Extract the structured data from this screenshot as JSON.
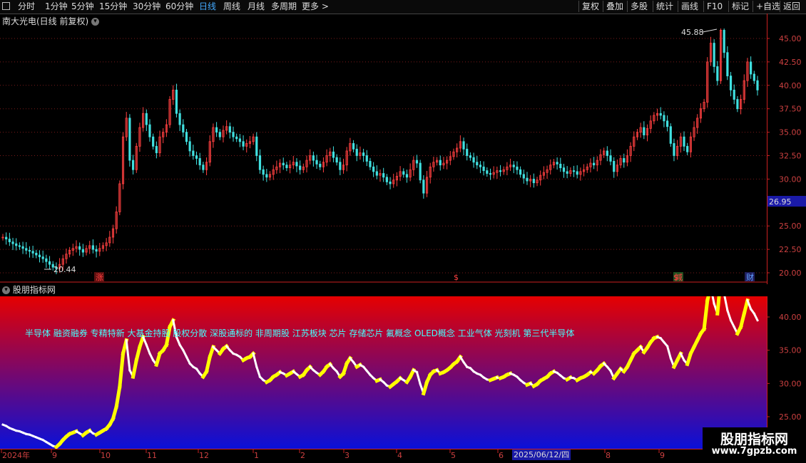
{
  "toolbar": {
    "periods": [
      "分时",
      "1分钟",
      "5分钟",
      "15分钟",
      "30分钟",
      "60分钟",
      "日线",
      "周线",
      "月线",
      "多周期",
      "更多 >"
    ],
    "active_period": "日线",
    "right_buttons": [
      "复权",
      "叠加",
      "多股",
      "统计",
      "画线",
      "F10",
      "标记",
      "+自选",
      "返回"
    ]
  },
  "stock": {
    "title": "南大光电(日线 前复权)"
  },
  "price_axis": {
    "labels": [
      "45.00",
      "42.50",
      "40.00",
      "37.50",
      "35.00",
      "32.50",
      "30.00",
      "25.00",
      "22.50",
      "20.00"
    ],
    "current_price": "26.95",
    "ylim": [
      19.5,
      46.5
    ]
  },
  "annotations": {
    "high": "45.88",
    "low": "20.44"
  },
  "markers": [
    "涨",
    "$",
    "$",
    "減",
    "财"
  ],
  "indicator": {
    "title": "股朋指标网",
    "axis_labels": [
      "40.00",
      "35.00",
      "30.00",
      "25.00"
    ],
    "concepts": "半导体 融资融券 专精特新 大基金持股 股权分散 深股通标的 非周期股 江苏板块 芯片 存储芯片 氟概念 OLED概念 工业气体 光刻机 第三代半导体"
  },
  "time_axis": {
    "labels": [
      "2024年",
      "9",
      "10",
      "11",
      "12",
      "1",
      "2",
      "3",
      "4",
      "5",
      "6",
      "8",
      "9"
    ],
    "highlight": "2025/06/12/四"
  },
  "watermark": {
    "title": "股朋指标网",
    "url": "www.7gpzb.com"
  },
  "colors": {
    "up": "#ff4040",
    "down": "#40e0e0",
    "bg": "#000000",
    "indicator_top": "#e00000",
    "indicator_bottom": "#0a10d0",
    "line_up": "#ffff00",
    "line_down": "#ffffff"
  },
  "chart_data": {
    "type": "line",
    "series": [
      {
        "values": [
          23.8,
          23.6,
          23.3,
          23.1,
          22.9,
          22.8,
          22.6,
          22.4,
          22.3,
          22.1,
          21.9,
          21.7,
          21.5,
          21.2,
          20.9,
          20.6,
          20.44,
          20.9,
          21.5,
          22.0,
          22.4,
          22.6,
          22.8,
          22.5,
          22.2,
          22.6,
          22.9,
          22.5,
          22.3,
          22.6,
          22.9,
          23.2,
          23.8,
          24.7,
          26.5,
          29.5,
          34.5,
          36.5,
          32.0,
          31.0,
          33.5,
          35.5,
          37.0,
          35.8,
          34.5,
          33.5,
          32.8,
          34.5,
          35.0,
          35.8,
          38.5,
          39.5,
          37.0,
          35.8,
          35.0,
          34.0,
          33.0,
          32.5,
          32.2,
          31.5,
          31.0,
          31.8,
          34.0,
          35.5,
          35.0,
          34.5,
          35.2,
          35.6,
          35.0,
          34.5,
          34.3,
          34.0,
          33.5,
          33.8,
          34.0,
          34.5,
          32.5,
          31.0,
          30.5,
          30.2,
          30.5,
          31.0,
          31.3,
          31.7,
          31.5,
          31.2,
          31.5,
          31.8,
          31.4,
          31.0,
          31.3,
          32.0,
          32.5,
          32.0,
          31.6,
          31.3,
          31.8,
          32.5,
          32.9,
          32.3,
          31.8,
          31.0,
          31.5,
          33.0,
          33.8,
          33.2,
          32.5,
          32.8,
          32.5,
          31.9,
          31.3,
          30.8,
          30.4,
          30.6,
          30.2,
          29.7,
          29.5,
          29.9,
          30.3,
          30.8,
          30.5,
          30.2,
          31.0,
          32.0,
          31.7,
          29.9,
          28.5,
          30.2,
          31.3,
          31.8,
          32.0,
          31.5,
          31.7,
          32.0,
          32.4,
          32.9,
          33.3,
          34.0,
          33.2,
          32.5,
          32.3,
          31.8,
          31.5,
          31.3,
          30.9,
          30.6,
          30.5,
          30.7,
          30.9,
          30.8,
          31.0,
          31.3,
          31.5,
          31.3,
          31.0,
          30.5,
          30.1,
          29.8,
          30.0,
          29.6,
          29.9,
          30.4,
          30.7,
          31.0,
          31.5,
          31.8,
          31.6,
          31.2,
          30.8,
          30.6,
          30.9,
          30.8,
          30.5,
          30.8,
          31.0,
          31.3,
          31.7,
          31.5,
          32.0,
          32.6,
          33.0,
          32.5,
          31.9,
          30.8,
          31.5,
          32.2,
          31.8,
          32.5,
          33.5,
          34.5,
          35.0,
          35.5,
          34.7,
          35.4,
          36.2,
          36.8,
          37.0,
          36.8,
          36.2,
          35.6,
          33.8,
          32.5,
          33.5,
          34.5,
          33.5,
          32.9,
          34.5,
          35.5,
          36.5,
          37.5,
          38.2,
          42.5,
          44.5,
          42.0,
          40.5,
          45.88,
          43.5,
          41.0,
          39.5,
          38.5,
          37.5,
          38.5,
          40.5,
          42.5,
          41.2,
          40.5,
          39.5
        ]
      }
    ],
    "ylim": [
      19.5,
      46.5
    ]
  }
}
